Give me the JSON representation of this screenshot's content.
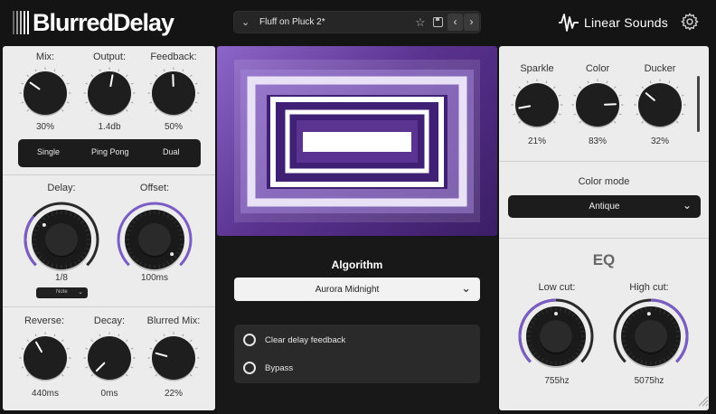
{
  "header": {
    "app_title": "BlurredDelay",
    "preset_name": "Fluff on Pluck 2*",
    "brand": "Linear Sounds"
  },
  "left_panel": {
    "row1": [
      {
        "label": "Mix:",
        "value": "30%"
      },
      {
        "label": "Output:",
        "value": "1.4db"
      },
      {
        "label": "Feedback:",
        "value": "50%"
      }
    ],
    "modes": [
      "Single",
      "Ping Pong",
      "Dual"
    ],
    "row2": [
      {
        "label": "Delay:",
        "value": "1/8"
      },
      {
        "label": "Offset:",
        "value": "100ms"
      }
    ],
    "note_select": "Note",
    "row3": [
      {
        "label": "Reverse:",
        "value": "440ms"
      },
      {
        "label": "Decay:",
        "value": "0ms"
      },
      {
        "label": "Blurred Mix:",
        "value": "22%"
      }
    ]
  },
  "center": {
    "algorithm_label": "Algorithm",
    "algorithm_value": "Aurora Midnight",
    "options": [
      "Clear delay feedback",
      "Bypass"
    ]
  },
  "right_panel": {
    "row1": [
      {
        "label": "Sparkle",
        "value": "21%"
      },
      {
        "label": "Color",
        "value": "83%"
      },
      {
        "label": "Ducker",
        "value": "32%"
      }
    ],
    "color_mode_label": "Color mode",
    "color_mode_value": "Antique",
    "eq_title": "EQ",
    "eq": [
      {
        "label": "Low cut:",
        "value": "755hz"
      },
      {
        "label": "High cut:",
        "value": "5075hz"
      }
    ]
  },
  "colors": {
    "accent": "#7b5cc4",
    "background": "#141414",
    "panel": "#ececec",
    "knob": "#1e1e1e"
  },
  "icons": [
    "chevron-down-icon",
    "star-icon",
    "save-icon",
    "chevron-left-icon",
    "chevron-right-icon",
    "linear-sounds-logo-icon",
    "gear-icon",
    "resize-grip-icon"
  ]
}
